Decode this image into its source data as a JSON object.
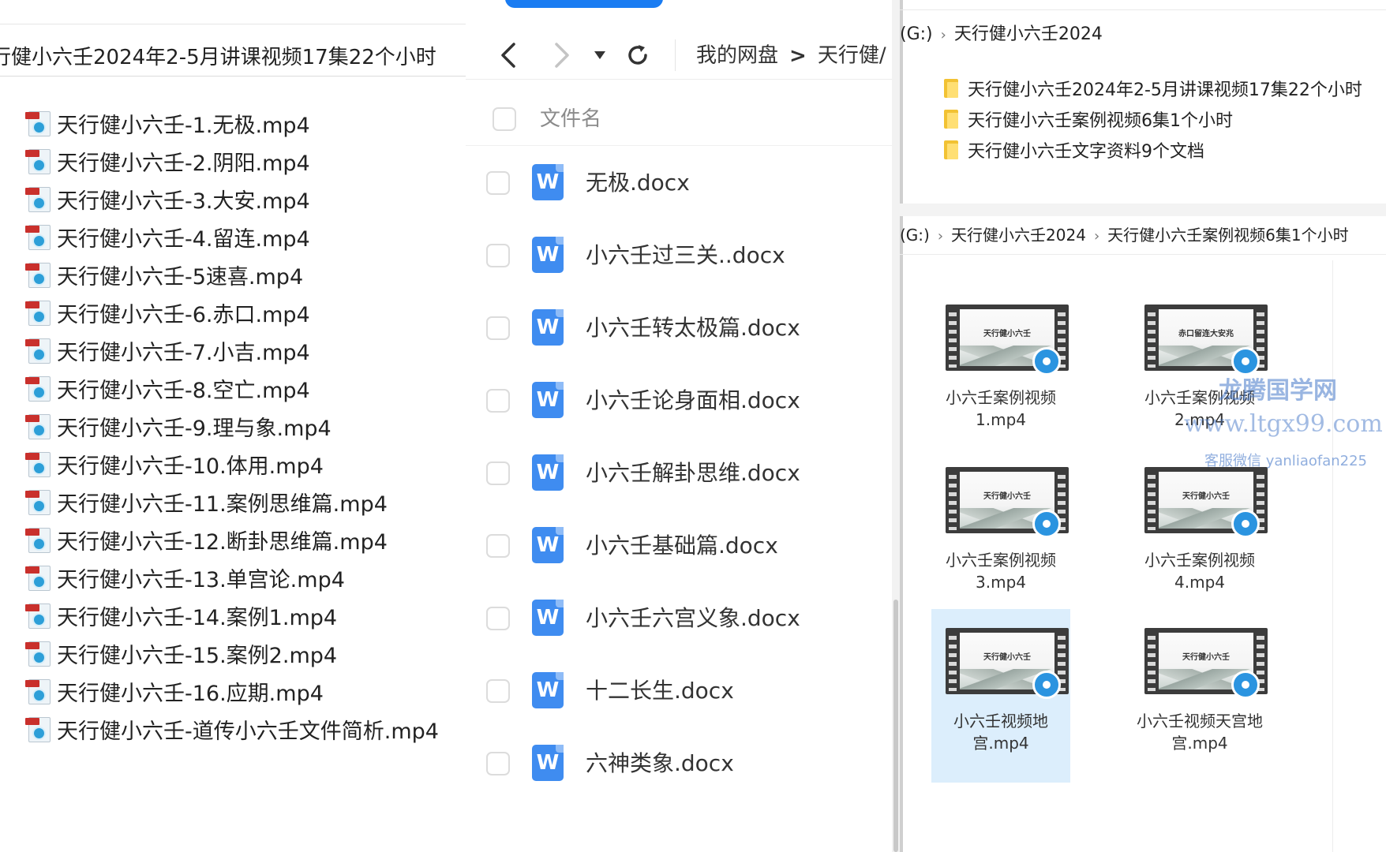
{
  "left": {
    "path": "行健小六壬2024年2-5月讲课视频17集22个小时",
    "videos": [
      "天行健小六壬-1.无极.mp4",
      "天行健小六壬-2.阴阳.mp4",
      "天行健小六壬-3.大安.mp4",
      "天行健小六壬-4.留连.mp4",
      "天行健小六壬-5速喜.mp4",
      "天行健小六壬-6.赤口.mp4",
      "天行健小六壬-7.小吉.mp4",
      "天行健小六壬-8.空亡.mp4",
      "天行健小六壬-9.理与象.mp4",
      "天行健小六壬-10.体用.mp4",
      "天行健小六壬-11.案例思维篇.mp4",
      "天行健小六壬-12.断卦思维篇.mp4",
      "天行健小六壬-13.单宫论.mp4",
      "天行健小六壬-14.案例1.mp4",
      "天行健小六壬-15.案例2.mp4",
      "天行健小六壬-16.应期.mp4",
      "天行健小六壬-道传小六壬文件简析.mp4"
    ]
  },
  "middle": {
    "breadcrumb": [
      "我的网盘",
      "天行健/"
    ],
    "column_header": "文件名",
    "files": [
      "无极.docx",
      "小六壬过三关..docx",
      "小六壬转太极篇.docx",
      "小六壬论身面相.docx",
      "小六壬解卦思维.docx",
      "小六壬基础篇.docx",
      "小六壬六宫义象.docx",
      "十二长生.docx",
      "六神类象.docx"
    ],
    "file_icon_letter": "W",
    "accent_color": "#1a7cf2"
  },
  "right": {
    "top_address": [
      "(G:)",
      "天行健小六壬2024"
    ],
    "folders": [
      "天行健小六壬2024年2-5月讲课视频17集22个小时",
      "天行健小六壬案例视频6集1个小时",
      "天行健小六壬文字资料9个文档"
    ],
    "second_address": [
      "(G:)",
      "天行健小六壬2024",
      "天行健小六壬案例视频6集1个小时"
    ],
    "tiles": [
      {
        "name": "小六壬案例视频1.mp4",
        "thumb_text": "天行健小六壬"
      },
      {
        "name": "小六壬案例视频2.mp4",
        "thumb_text": "赤口留连大安兆"
      },
      {
        "name": "小六壬案例视频3.mp4",
        "thumb_text": "天行健小六壬"
      },
      {
        "name": "小六壬案例视频4.mp4",
        "thumb_text": "天行健小六壬"
      },
      {
        "name": "小六壬视频地宫.mp4",
        "thumb_text": "天行健小六壬",
        "selected": true
      },
      {
        "name": "小六壬视频天宫地宫.mp4",
        "thumb_text": "天行健小六壬"
      }
    ]
  },
  "watermark": {
    "site_name": "龙腾国学网",
    "url": "www.ltgx99.com",
    "contact": "客服微信 yanliaofan225"
  }
}
